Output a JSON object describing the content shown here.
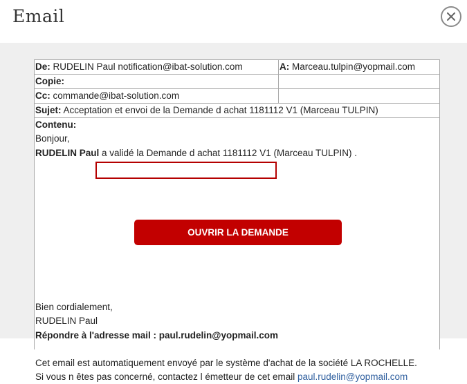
{
  "dialog": {
    "title": "Email"
  },
  "email": {
    "from_label": "De:",
    "from_value": "RUDELIN Paul notification@ibat-solution.com",
    "to_label": "A:",
    "to_value": "Marceau.tulpin@yopmail.com",
    "copy_label": "Copie:",
    "cc_label": "Cc:",
    "cc_value": "commande@ibat-solution.com",
    "subject_label": "Sujet:",
    "subject_value": "Acceptation et envoi de la Demande d achat 1181112 V1 (Marceau TULPIN)",
    "content_label": "Contenu:",
    "greeting": "Bonjour,",
    "sender_name": "RUDELIN Paul",
    "validated_text": "a validé la Demande d achat 1181112 V1",
    "validated_suffix": "(Marceau TULPIN) .",
    "cta_label": "OUVRIR LA DEMANDE",
    "closing": "Bien cordialement,",
    "signature": "RUDELIN Paul",
    "reply_line": "Répondre à l'adresse mail : paul.rudelin@yopmail.com",
    "auto_notice": "Cet email est automatiquement envoyé par le système d'achat de la société LA ROCHELLE.",
    "not_concerned": "Si vous n êtes pas concerné, contactez l émetteur de cet email",
    "contact_link": "paul.rudelin@yopmail.com"
  },
  "colors": {
    "cta_background": "#c20000",
    "highlight_border": "#b40000",
    "link": "#2f5f9f",
    "backdrop": "#efefef"
  },
  "icons": {
    "close": "close-icon"
  }
}
